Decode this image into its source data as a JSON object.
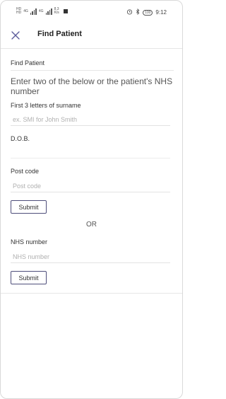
{
  "status_bar": {
    "left_label_top": "HD",
    "left_label_bottom": "HD",
    "network_label_1": "4G",
    "network_label_2": "4G",
    "speed_value": "8.3",
    "speed_unit": "K/s",
    "battery": "100",
    "time": "9:12",
    "alarm_icon": "alarm-icon",
    "bluetooth_icon": "bluetooth-icon"
  },
  "header": {
    "title": "Find Patient",
    "close_icon": "close-icon"
  },
  "form": {
    "section_title": "Find Patient",
    "instructions": "Enter two of the below or the patient's NHS number",
    "surname_label": "First 3 letters of surname",
    "surname_placeholder": "ex. SMI for John Smith",
    "dob_label": "D.O.B.",
    "postcode_label": "Post code",
    "postcode_placeholder": "Post code",
    "submit_label_1": "Submit",
    "or_text": "OR",
    "nhs_label": "NHS number",
    "nhs_placeholder": "NHS number",
    "submit_label_2": "Submit"
  },
  "colors": {
    "accent": "#4e4e7a",
    "close_icon": "#5b5b9a"
  }
}
